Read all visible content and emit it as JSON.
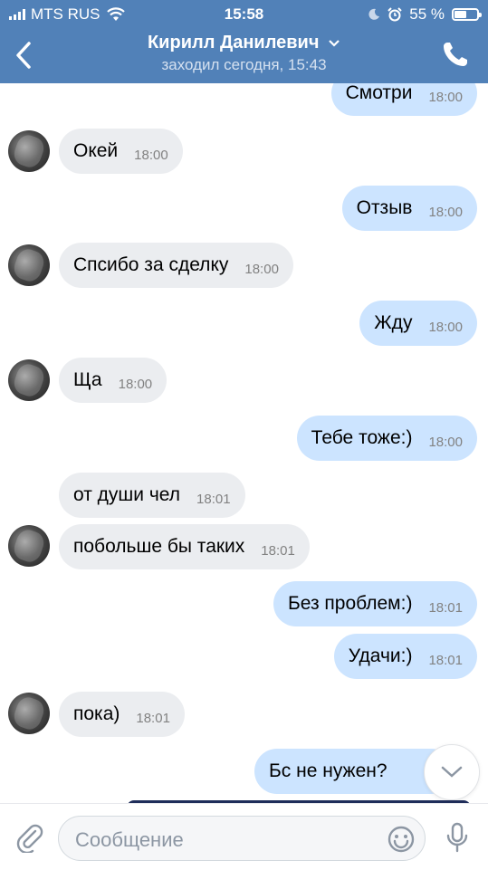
{
  "status_bar": {
    "carrier": "MTS RUS",
    "time": "15:58",
    "battery": "55 %",
    "battery_level": 0.55
  },
  "nav": {
    "back_icon": "chevron-left-icon",
    "title": "Кирилл Данилевич",
    "title_chevron": "chevron-down-icon",
    "subtitle": "заходил сегодня, 15:43",
    "call_icon": "phone-icon"
  },
  "messages": [
    {
      "dir": "out",
      "text": "Смотри",
      "time": "18:00"
    },
    {
      "dir": "in",
      "text": "Окей",
      "time": "18:00",
      "avatar": true
    },
    {
      "dir": "out",
      "text": "Отзыв",
      "time": "18:00"
    },
    {
      "dir": "in",
      "text": "Спсибо за сделку",
      "time": "18:00",
      "avatar": true
    },
    {
      "dir": "out",
      "text": "Жду",
      "time": "18:00"
    },
    {
      "dir": "in",
      "text": "Ща",
      "time": "18:00",
      "avatar": true
    },
    {
      "dir": "out",
      "text": "Тебе тоже:)",
      "time": "18:00"
    },
    {
      "dir": "in",
      "text": "от души чел",
      "time": "18:01",
      "avatar": false
    },
    {
      "dir": "in",
      "text": "побольше бы таких",
      "time": "18:01",
      "avatar": true
    },
    {
      "dir": "out",
      "text": "Без проблем:)",
      "time": "18:01"
    },
    {
      "dir": "out",
      "text": "Удачи:)",
      "time": "18:01"
    },
    {
      "dir": "in",
      "text": "пока)",
      "time": "18:01",
      "avatar": true
    },
    {
      "dir": "out",
      "text": "Бс не нужен?",
      "time": ""
    }
  ],
  "composer": {
    "placeholder": "Сообщение",
    "attach_icon": "paperclip-icon",
    "emoji_icon": "smiley-icon",
    "mic_icon": "microphone-icon"
  },
  "colors": {
    "header": "#5181b8",
    "incoming_bubble": "#ebedf0",
    "outgoing_bubble": "#cce4ff"
  }
}
